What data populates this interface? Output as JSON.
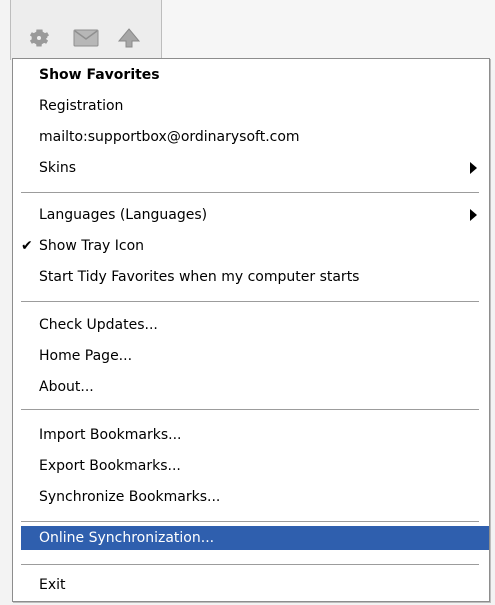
{
  "menu": {
    "items": [
      {
        "label": "Show Favorites"
      },
      {
        "label": "Registration"
      },
      {
        "label": "mailto:supportbox@ordinarysoft.com"
      },
      {
        "label": "Skins"
      },
      {
        "label": "Languages (Languages)"
      },
      {
        "label": "Show Tray Icon"
      },
      {
        "label": "Start Tidy Favorites when my computer starts"
      },
      {
        "label": "Check Updates..."
      },
      {
        "label": "Home Page..."
      },
      {
        "label": "About..."
      },
      {
        "label": "Import Bookmarks..."
      },
      {
        "label": "Export Bookmarks..."
      },
      {
        "label": "Synchronize Bookmarks..."
      },
      {
        "label": "Online Synchronization..."
      },
      {
        "label": "Exit"
      }
    ],
    "highlight_color": "#2f5fae"
  },
  "toolbar": {
    "icons": [
      "gear-icon",
      "mail-icon",
      "arrow-up-icon"
    ]
  }
}
